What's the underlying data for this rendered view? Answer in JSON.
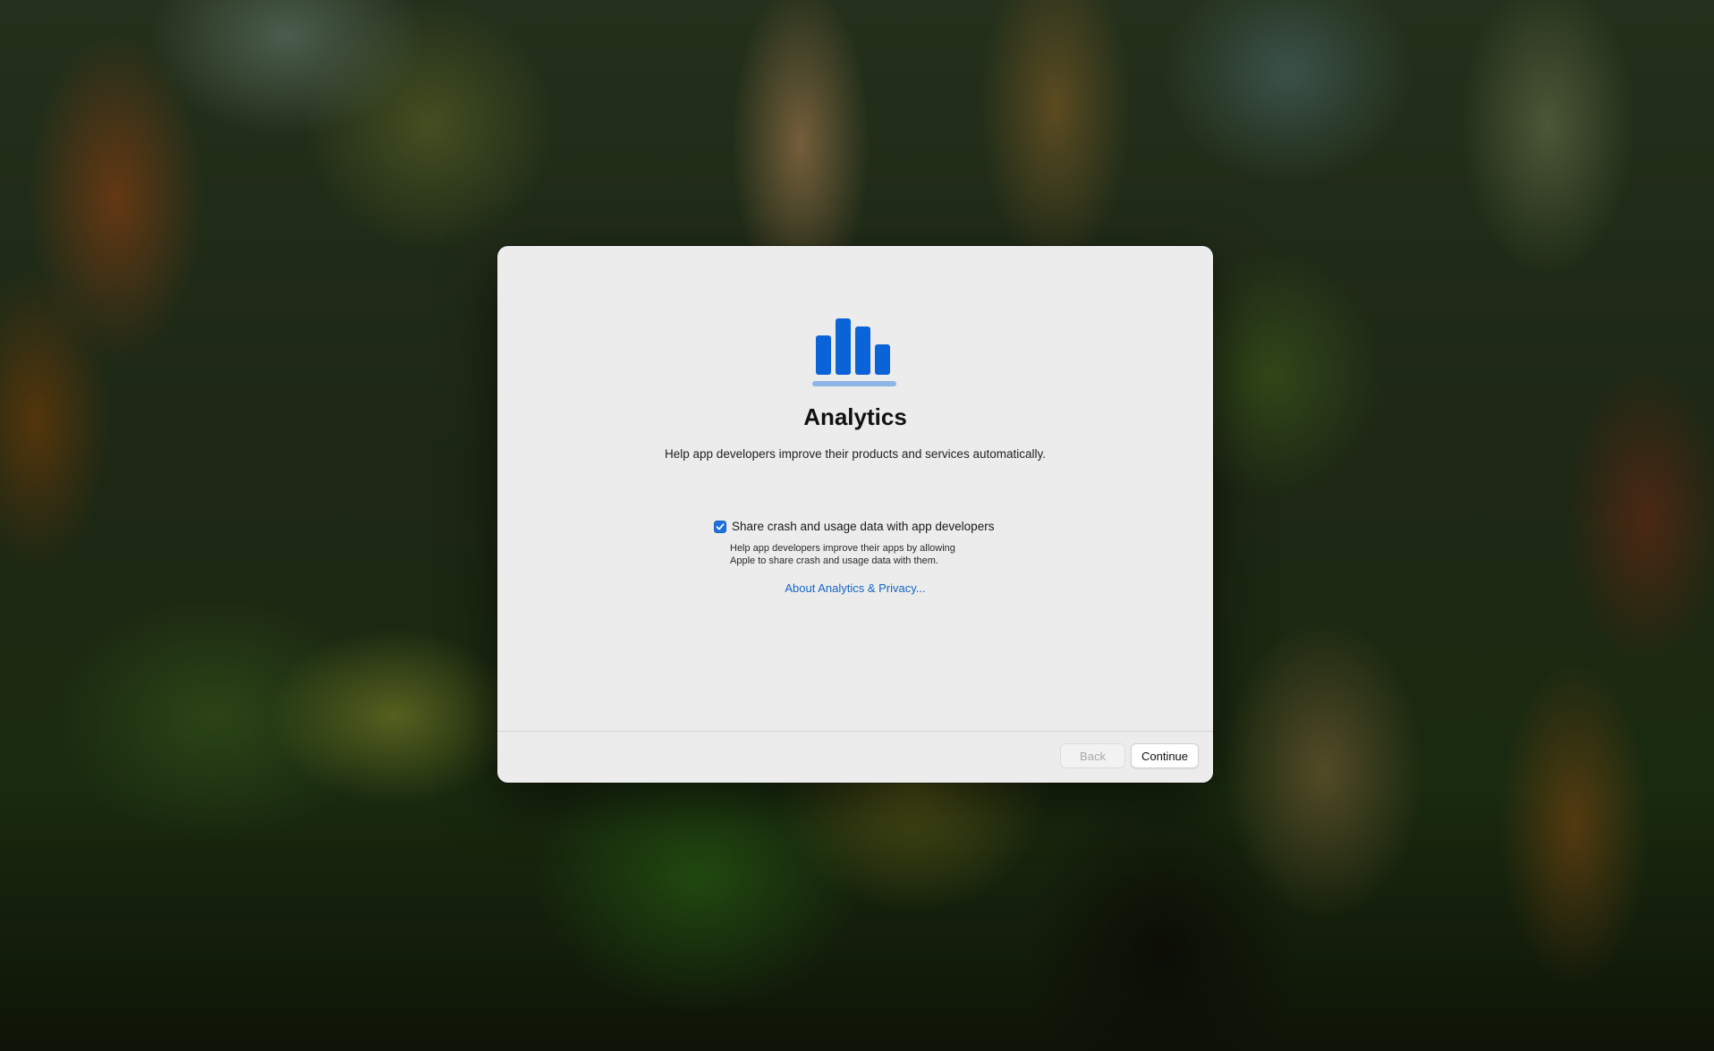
{
  "dialog": {
    "icon": "bar-chart-icon",
    "title": "Analytics",
    "subtitle": "Help app developers improve their products and services automatically.",
    "option": {
      "label": "Share crash and usage data with app developers",
      "checked": true,
      "description_line1": "Help app developers improve their apps by allowing",
      "description_line2": "Apple to share crash and usage data with them."
    },
    "privacy_link": "About Analytics & Privacy..."
  },
  "footer": {
    "back_label": "Back",
    "back_enabled": false,
    "continue_label": "Continue"
  },
  "colors": {
    "accent": "#1f6fdc",
    "link": "#1565c9",
    "icon_bar": "#0a64d8",
    "icon_base": "#8fb4e6",
    "window_bg": "#ececec"
  }
}
